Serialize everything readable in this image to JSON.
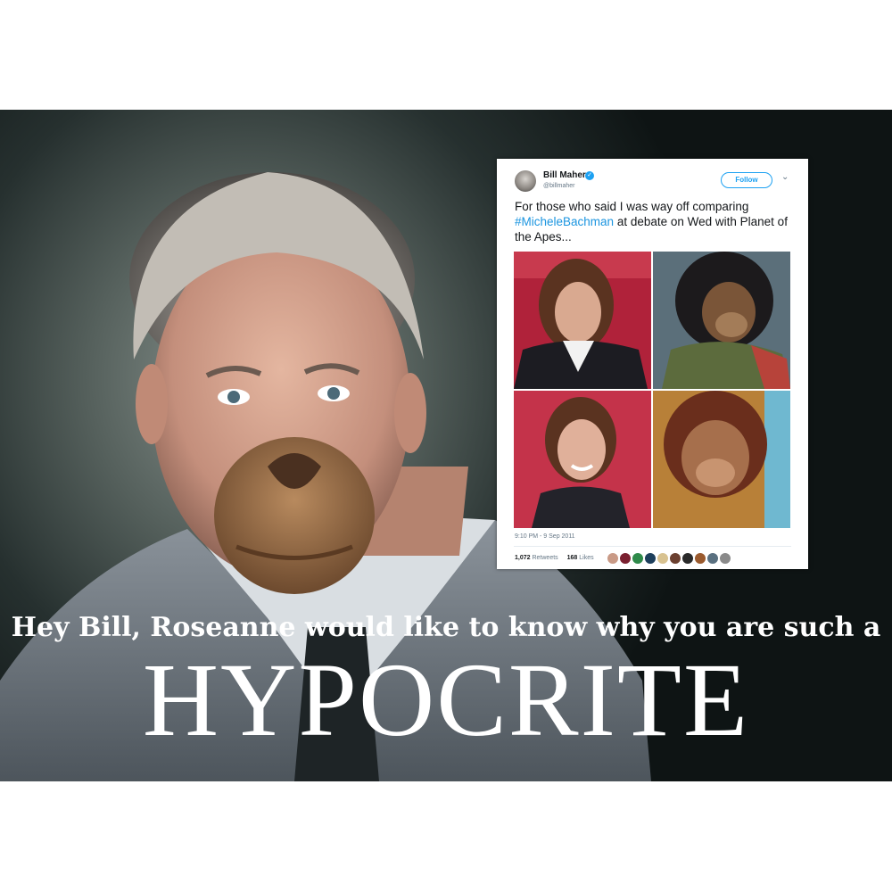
{
  "tweet": {
    "display_name": "Bill Maher",
    "handle": "@billmaher",
    "follow_label": "Follow",
    "text_before": "For those who said I was way off comparing",
    "hashtag": "#MicheleBachman",
    "text_after": " at debate on Wed with Planet of the Apes...",
    "timestamp": "9:10 PM - 9 Sep 2011",
    "retweets_count": "1,072",
    "retweets_label": "Retweets",
    "likes_count": "168",
    "likes_label": "Likes"
  },
  "caption": {
    "line1": "Hey Bill, Roseanne would like to know why you are such a",
    "line2": "HYPOCRITE"
  },
  "colors": {
    "twitter_blue": "#1da1f2",
    "link_blue": "#1b95e0",
    "caption_text": "#ffffff"
  },
  "icons": [
    "verified-badge-icon",
    "chevron-down-icon"
  ]
}
